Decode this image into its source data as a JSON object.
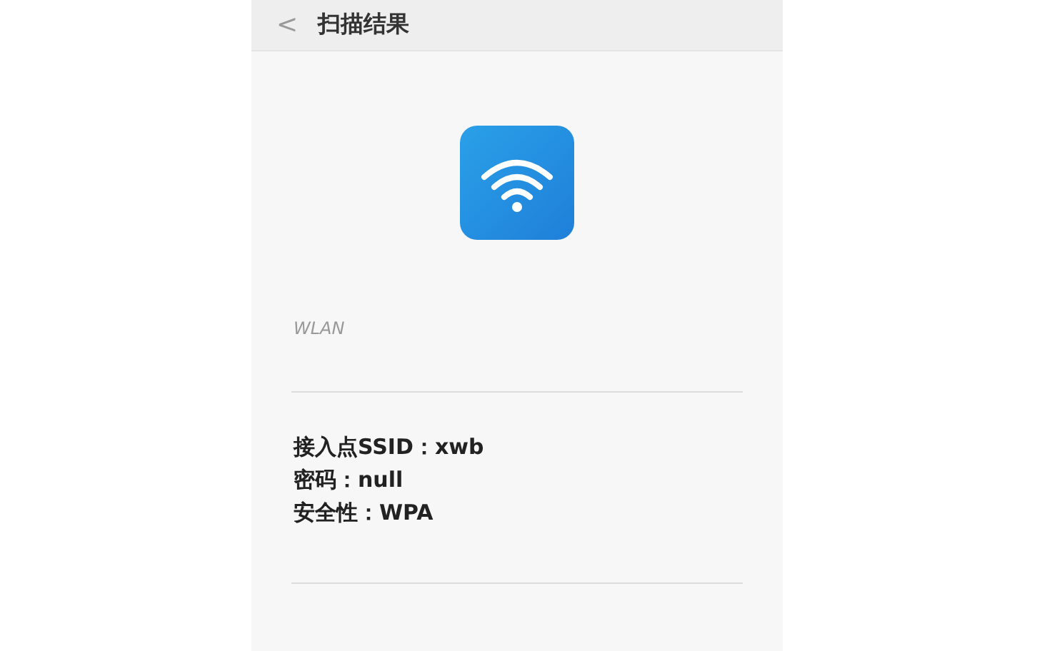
{
  "header": {
    "back": "<",
    "title": "扫描结果"
  },
  "type_label": "WLAN",
  "details": [
    "接入点SSID：xwb",
    "密码：null",
    "安全性：WPA"
  ]
}
